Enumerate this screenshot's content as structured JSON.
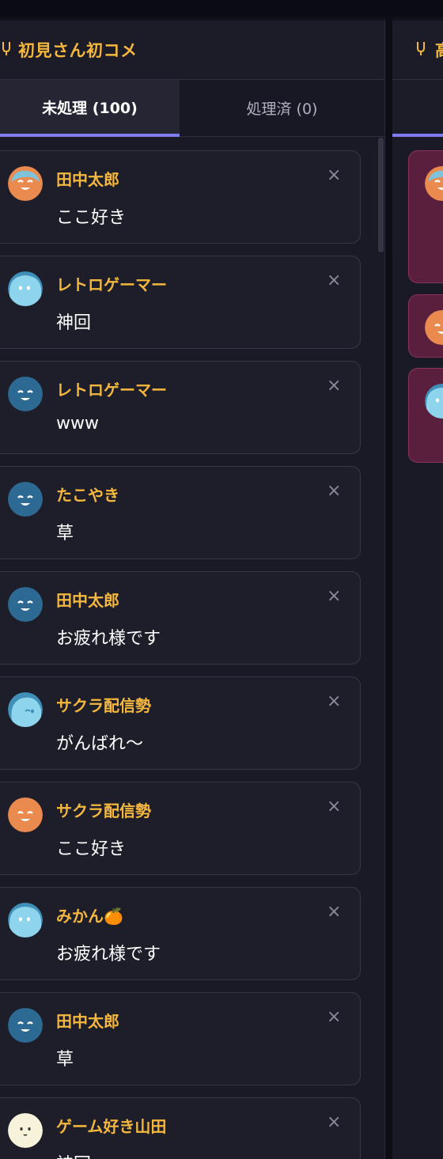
{
  "left_panel": {
    "header": {
      "icon": "mic-icon",
      "title": "初見さん初コメ"
    },
    "tabs": [
      {
        "label": "未処理 (100)",
        "active": true
      },
      {
        "label": "処理済 (0)",
        "active": false
      }
    ],
    "comments": [
      {
        "user": "田中太郎",
        "text": "ここ好き",
        "avatar": "orange-face"
      },
      {
        "user": "レトロゲーマー",
        "text": "神回",
        "avatar": "lightblue-ghost"
      },
      {
        "user": "レトロゲーマー",
        "text": "www",
        "avatar": "blue-face"
      },
      {
        "user": "たこやき",
        "text": "草",
        "avatar": "blue-face"
      },
      {
        "user": "田中太郎",
        "text": "お疲れ様です",
        "avatar": "blue-face"
      },
      {
        "user": "サクラ配信勢",
        "text": "がんばれ〜",
        "avatar": "lightblue-wink"
      },
      {
        "user": "サクラ配信勢",
        "text": "ここ好き",
        "avatar": "orange-face"
      },
      {
        "user": "みかん🍊",
        "text": "お疲れ様です",
        "avatar": "lightblue-ghost"
      },
      {
        "user": "田中太郎",
        "text": "草",
        "avatar": "blue-face"
      },
      {
        "user": "ゲーム好き山田",
        "text": "神回",
        "avatar": "cream-face"
      }
    ],
    "close_glyph": "×"
  },
  "right_panel": {
    "header": {
      "icon": "mic-icon",
      "title": "高"
    }
  },
  "colors": {
    "accent": "#f5b83d",
    "tab_indicator": "#7f7cf0",
    "highlight_card": "#5a1f3c"
  }
}
